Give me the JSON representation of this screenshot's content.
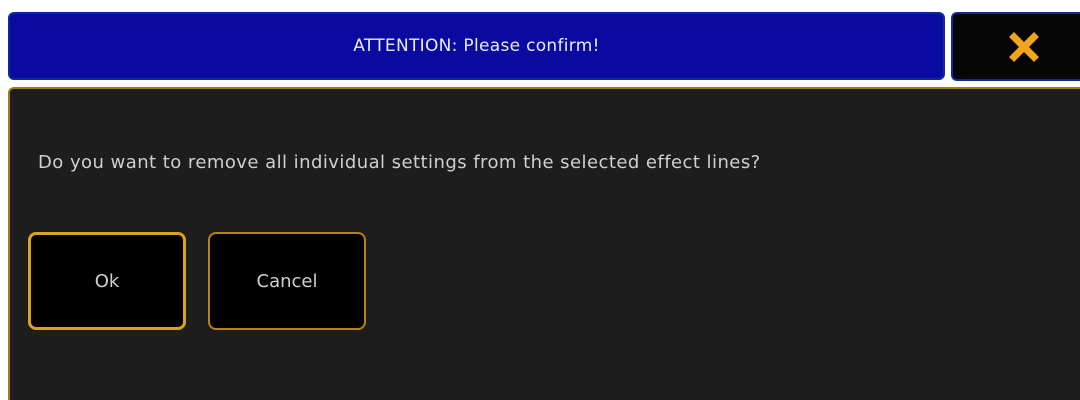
{
  "dialog": {
    "title": "ATTENTION: Please confirm!",
    "close_icon": "close-x-icon",
    "message": "Do you want to remove all individual settings from the selected effect lines?",
    "buttons": {
      "ok_label": "Ok",
      "cancel_label": "Cancel"
    }
  },
  "colors": {
    "titlebar_bg": "#0a0aa0",
    "panel_bg": "#1d1d1d",
    "panel_border": "#a07c12",
    "button_border": "#d8a21a",
    "close_icon": "#f2a51a",
    "text": "#cfcfcf"
  }
}
